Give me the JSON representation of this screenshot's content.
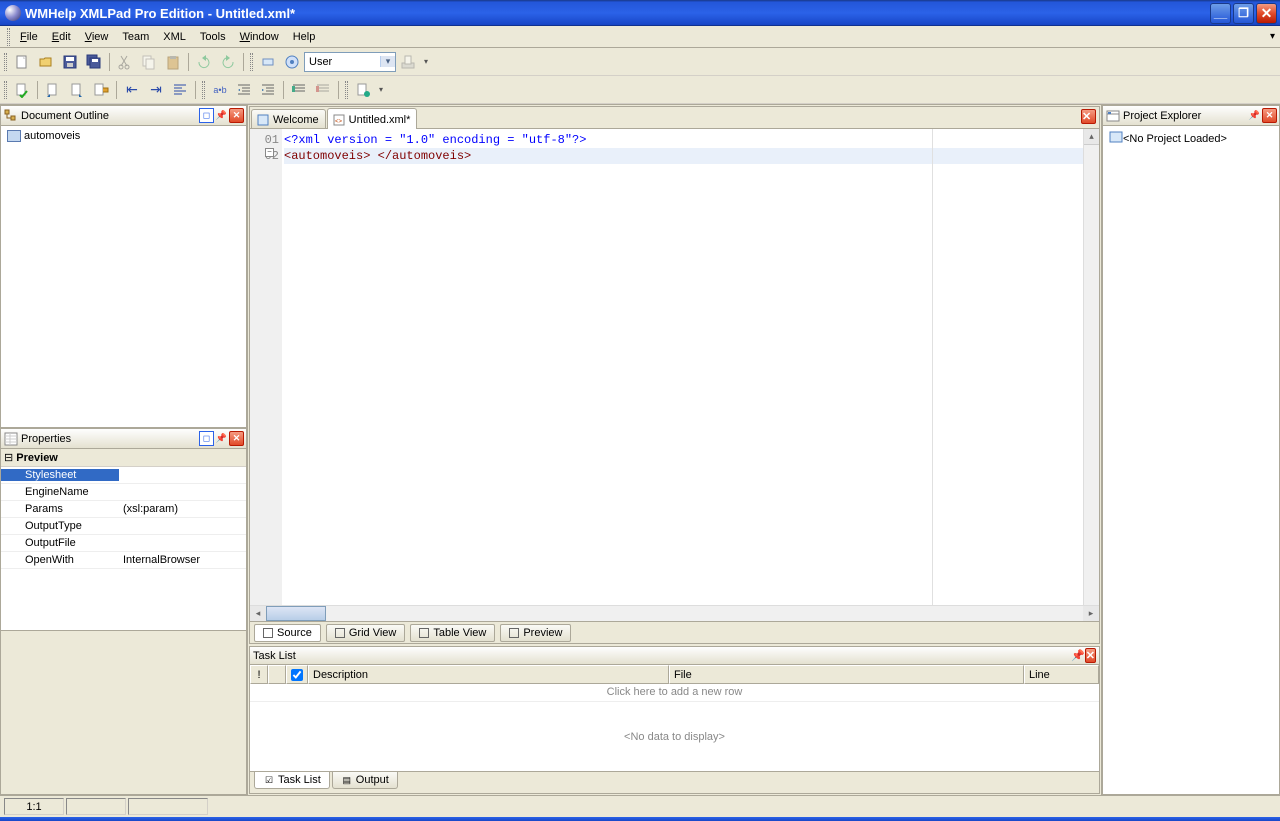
{
  "window": {
    "title": "WMHelp XMLPad Pro Edition - Untitled.xml*"
  },
  "menu": {
    "file": "File",
    "edit": "Edit",
    "view": "View",
    "team": "Team",
    "xml": "XML",
    "tools": "Tools",
    "window": "Window",
    "help": "Help"
  },
  "toolbar": {
    "schema_combo": "User"
  },
  "outline": {
    "title": "Document Outline",
    "root": "automoveis"
  },
  "properties": {
    "title": "Properties",
    "section": "Preview",
    "rows": {
      "stylesheet": "Stylesheet",
      "engine": "EngineName",
      "params": "Params",
      "params_val": "(xsl:param)",
      "outtype": "OutputType",
      "outfile": "OutputFile",
      "openwith": "OpenWith",
      "openwith_val": "InternalBrowser"
    }
  },
  "tabs": {
    "welcome": "Welcome",
    "untitled": "Untitled.xml*"
  },
  "code": {
    "l1": "<?xml version = \"1.0\" encoding = \"utf-8\"?>",
    "l2a": "<automoveis>",
    "l2b": " </automoveis>",
    "g1": "01",
    "g2": "02"
  },
  "viewtabs": {
    "source": "Source",
    "grid": "Grid View",
    "table": "Table View",
    "preview": "Preview"
  },
  "tasklist": {
    "title": "Task List",
    "col_desc": "Description",
    "col_file": "File",
    "col_line": "Line",
    "addrow": "Click here to add a new row",
    "nodata": "<No data to display>",
    "tab_tasks": "Task List",
    "tab_output": "Output"
  },
  "explorer": {
    "title": "Project Explorer",
    "noproject": "<No Project Loaded>"
  },
  "status": {
    "pos": "1:1"
  }
}
